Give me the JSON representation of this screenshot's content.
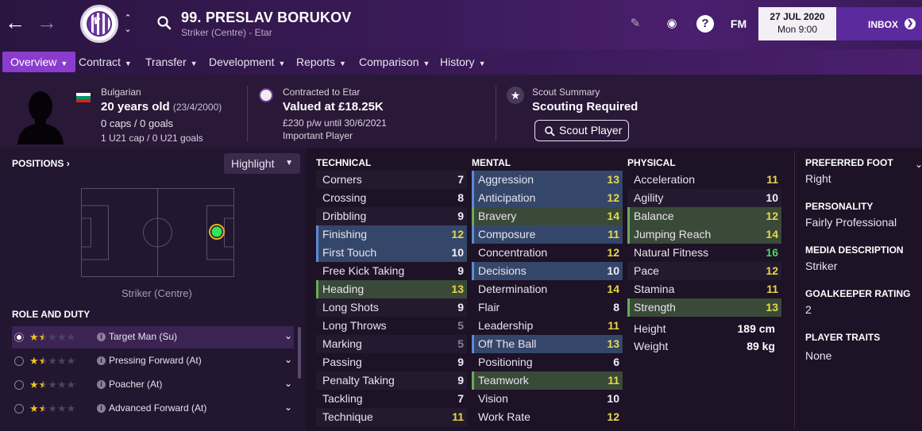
{
  "header": {
    "player_name": "99. PRESLAV BORUKOV",
    "player_sub": "Striker (Centre) - Etar",
    "fm_label": "FM",
    "help_label": "?",
    "date": "27 JUL 2020",
    "day_time": "Mon 9:00",
    "inbox_label": "INBOX"
  },
  "tabs": [
    {
      "label": "Overview"
    },
    {
      "label": "Contract"
    },
    {
      "label": "Transfer"
    },
    {
      "label": "Development"
    },
    {
      "label": "Reports"
    },
    {
      "label": "Comparison"
    },
    {
      "label": "History"
    }
  ],
  "info": {
    "nationality": "Bulgarian",
    "age": "20 years old",
    "dob": "(23/4/2000)",
    "caps": "0 caps / 0 goals",
    "u21": "1 U21 cap / 0 U21 goals",
    "contract_label": "Contracted to Etar",
    "value": "Valued at £18.25K",
    "wage": "£230 p/w until 30/6/2021",
    "status": "Important Player",
    "scout_label": "Scout Summary",
    "scout_value": "Scouting Required",
    "scout_button": "Scout Player"
  },
  "positions": {
    "title": "POSITIONS",
    "title_arrow": "›",
    "highlight": "Highlight",
    "caption": "Striker (Centre)"
  },
  "roles": {
    "title": "ROLE AND DUTY",
    "items": [
      {
        "label": "Target Man (Su)",
        "stars": 1.5
      },
      {
        "label": "Pressing Forward (At)",
        "stars": 1.5
      },
      {
        "label": "Poacher (At)",
        "stars": 1.5
      },
      {
        "label": "Advanced Forward (At)",
        "stars": 1.5
      }
    ]
  },
  "technical": {
    "title": "TECHNICAL",
    "rows": [
      {
        "name": "Corners",
        "value": "7"
      },
      {
        "name": "Crossing",
        "value": "8"
      },
      {
        "name": "Dribbling",
        "value": "9"
      },
      {
        "name": "Finishing",
        "value": "12"
      },
      {
        "name": "First Touch",
        "value": "10"
      },
      {
        "name": "Free Kick Taking",
        "value": "9"
      },
      {
        "name": "Heading",
        "value": "13"
      },
      {
        "name": "Long Shots",
        "value": "9"
      },
      {
        "name": "Long Throws",
        "value": "5"
      },
      {
        "name": "Marking",
        "value": "5"
      },
      {
        "name": "Passing",
        "value": "9"
      },
      {
        "name": "Penalty Taking",
        "value": "9"
      },
      {
        "name": "Tackling",
        "value": "7"
      },
      {
        "name": "Technique",
        "value": "11"
      }
    ]
  },
  "mental": {
    "title": "MENTAL",
    "rows": [
      {
        "name": "Aggression",
        "value": "13"
      },
      {
        "name": "Anticipation",
        "value": "12"
      },
      {
        "name": "Bravery",
        "value": "14"
      },
      {
        "name": "Composure",
        "value": "11"
      },
      {
        "name": "Concentration",
        "value": "12"
      },
      {
        "name": "Decisions",
        "value": "10"
      },
      {
        "name": "Determination",
        "value": "14"
      },
      {
        "name": "Flair",
        "value": "8"
      },
      {
        "name": "Leadership",
        "value": "11"
      },
      {
        "name": "Off The Ball",
        "value": "13"
      },
      {
        "name": "Positioning",
        "value": "6"
      },
      {
        "name": "Teamwork",
        "value": "11"
      },
      {
        "name": "Vision",
        "value": "10"
      },
      {
        "name": "Work Rate",
        "value": "12"
      }
    ]
  },
  "physical": {
    "title": "PHYSICAL",
    "rows": [
      {
        "name": "Acceleration",
        "value": "11"
      },
      {
        "name": "Agility",
        "value": "10"
      },
      {
        "name": "Balance",
        "value": "12"
      },
      {
        "name": "Jumping Reach",
        "value": "14"
      },
      {
        "name": "Natural Fitness",
        "value": "16"
      },
      {
        "name": "Pace",
        "value": "12"
      },
      {
        "name": "Stamina",
        "value": "11"
      },
      {
        "name": "Strength",
        "value": "13"
      }
    ],
    "height_label": "Height",
    "height_value": "189 cm",
    "weight_label": "Weight",
    "weight_value": "89 kg"
  },
  "details": {
    "foot_title": "PREFERRED FOOT",
    "foot": "Right",
    "personality_title": "PERSONALITY",
    "personality": "Fairly Professional",
    "media_title": "MEDIA DESCRIPTION",
    "media": "Striker",
    "gk_title": "GOALKEEPER RATING",
    "gk": "2",
    "traits_title": "PLAYER TRAITS",
    "traits": "None"
  },
  "colors": {
    "accent": "#8a3ccc",
    "inbox": "#5b2a9c",
    "highlight_blue": "#34476a",
    "highlight_green": "#3a4a38",
    "value_yellow": "#e8d84a",
    "value_green": "#4ed86a",
    "star": "#f0c419"
  }
}
